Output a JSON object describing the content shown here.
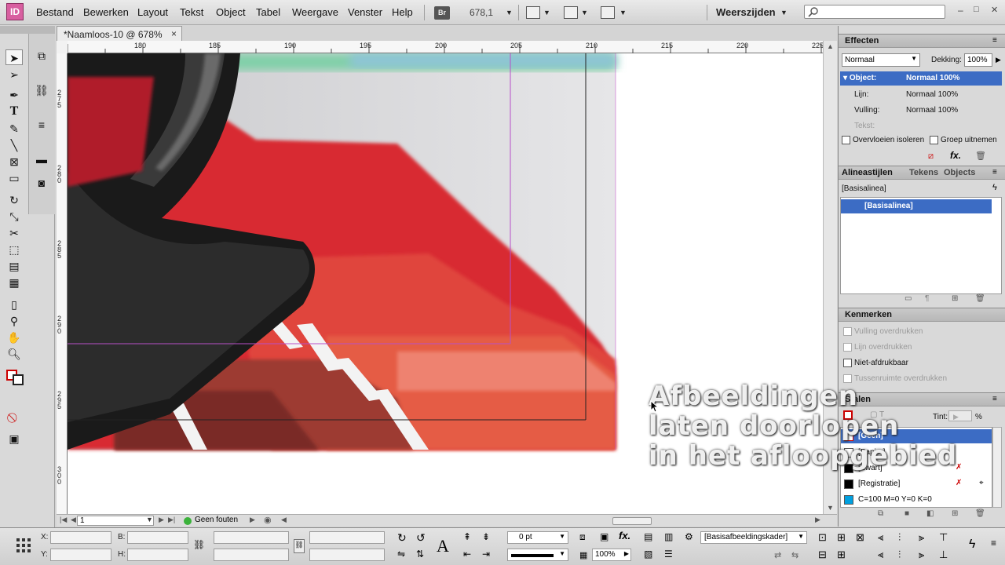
{
  "app": {
    "logo": "ID"
  },
  "menu": [
    "Bestand",
    "Bewerken",
    "Layout",
    "Tekst",
    "Object",
    "Tabel",
    "Weergave",
    "Venster",
    "Help"
  ],
  "toolbar": {
    "br": "Br",
    "zoom": "678,1",
    "workspace": "Weerszijden"
  },
  "window": {
    "minimize": "–",
    "maximize": "□",
    "close": "✕"
  },
  "document": {
    "tab_title": "*Naamloos-10 @ 678%",
    "close": "×"
  },
  "ruler_h": [
    "180",
    "185",
    "190",
    "195",
    "200",
    "205",
    "210",
    "215",
    "220",
    "225"
  ],
  "ruler_v": [
    "275",
    "280",
    "285",
    "290",
    "295",
    "300"
  ],
  "status": {
    "page": "1",
    "preflight": "Geen fouten"
  },
  "effects": {
    "title": "Effecten",
    "blend_mode": "Normaal",
    "opacity_label": "Dekking:",
    "opacity_value": "100%",
    "rows": [
      {
        "label": "Object:",
        "value": "Normaal 100%"
      },
      {
        "label": "Lijn:",
        "value": "Normaal 100%"
      },
      {
        "label": "Vulling:",
        "value": "Normaal 100%"
      },
      {
        "label": "Tekst:",
        "value": ""
      }
    ],
    "isolate": "Overvloeien isoleren",
    "knockout": "Groep uitnemen",
    "fx": "fx."
  },
  "paragraph_styles": {
    "tabs": [
      "Alineastijlen",
      "Tekens",
      "Objects"
    ],
    "current": "[Basisalinea]",
    "items": [
      "[Basisalinea]"
    ]
  },
  "attributes": {
    "title": "Kenmerken",
    "items": [
      "Vulling overdrukken",
      "Lijn overdrukken",
      "Niet-afdrukbaar",
      "Tussenruimte overdrukken"
    ]
  },
  "swatches": {
    "title": "Stalen",
    "tint_label": "Tint:",
    "tint_unit": "%",
    "items": [
      "[Geen]",
      "[Papier]",
      "[Zwart]",
      "[Registratie]",
      "C=100 M=0 Y=0 K=0"
    ]
  },
  "overlay": {
    "text": "Afbeeldingen\nlaten doorlopen\nin het afloopgebied"
  },
  "control_bar": {
    "x_label": "X:",
    "y_label": "Y:",
    "b_label": "B:",
    "h_label": "H:",
    "stroke_weight": "0 pt",
    "opacity": "100%",
    "frame_style": "[Basisafbeeldingskader]",
    "fx": "fx."
  },
  "colors": {
    "accent": "#3c6cc4",
    "frame_guide": "#b84fc8",
    "brand": "#d85fa0"
  }
}
